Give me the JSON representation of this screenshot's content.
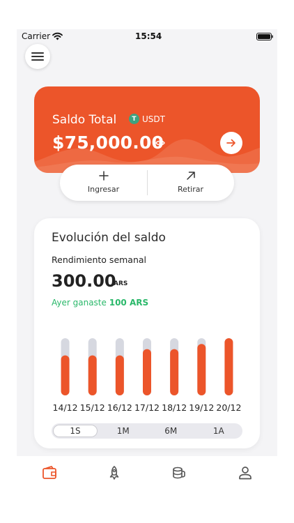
{
  "status_bar": {
    "carrier": "Carrier",
    "time": "15:54"
  },
  "balance": {
    "label": "Saldo Total",
    "currency": "USDT",
    "amount": "$75,000.00",
    "accent_color": "#ec552a"
  },
  "actions": {
    "deposit_label": "Ingresar",
    "withdraw_label": "Retirar"
  },
  "evolution": {
    "title": "Evolución del saldo",
    "performance_label": "Rendimiento semanal",
    "performance_value": "300.00",
    "performance_unit": "ARS",
    "gain_prefix": "Ayer ganaste",
    "gain_amount": "100 ARS",
    "periods": [
      "1S",
      "1M",
      "6M",
      "1A"
    ],
    "selected_period": "1S"
  },
  "chart_data": {
    "type": "bar",
    "categories": [
      "14/12",
      "15/12",
      "16/12",
      "17/12",
      "18/12",
      "19/12",
      "20/12"
    ],
    "values": [
      0.7,
      0.7,
      0.7,
      0.81,
      0.81,
      0.9,
      1.0
    ],
    "ylim": [
      0,
      1
    ],
    "bar_color": "#ec552a",
    "track_color": "#d6d8e0",
    "grid": false
  },
  "tab_bar": {
    "items": [
      "wallet-icon",
      "rocket-icon",
      "coins-icon",
      "user-icon"
    ],
    "active": "wallet-icon",
    "active_color": "#ec552a",
    "inactive_color": "#555555"
  }
}
